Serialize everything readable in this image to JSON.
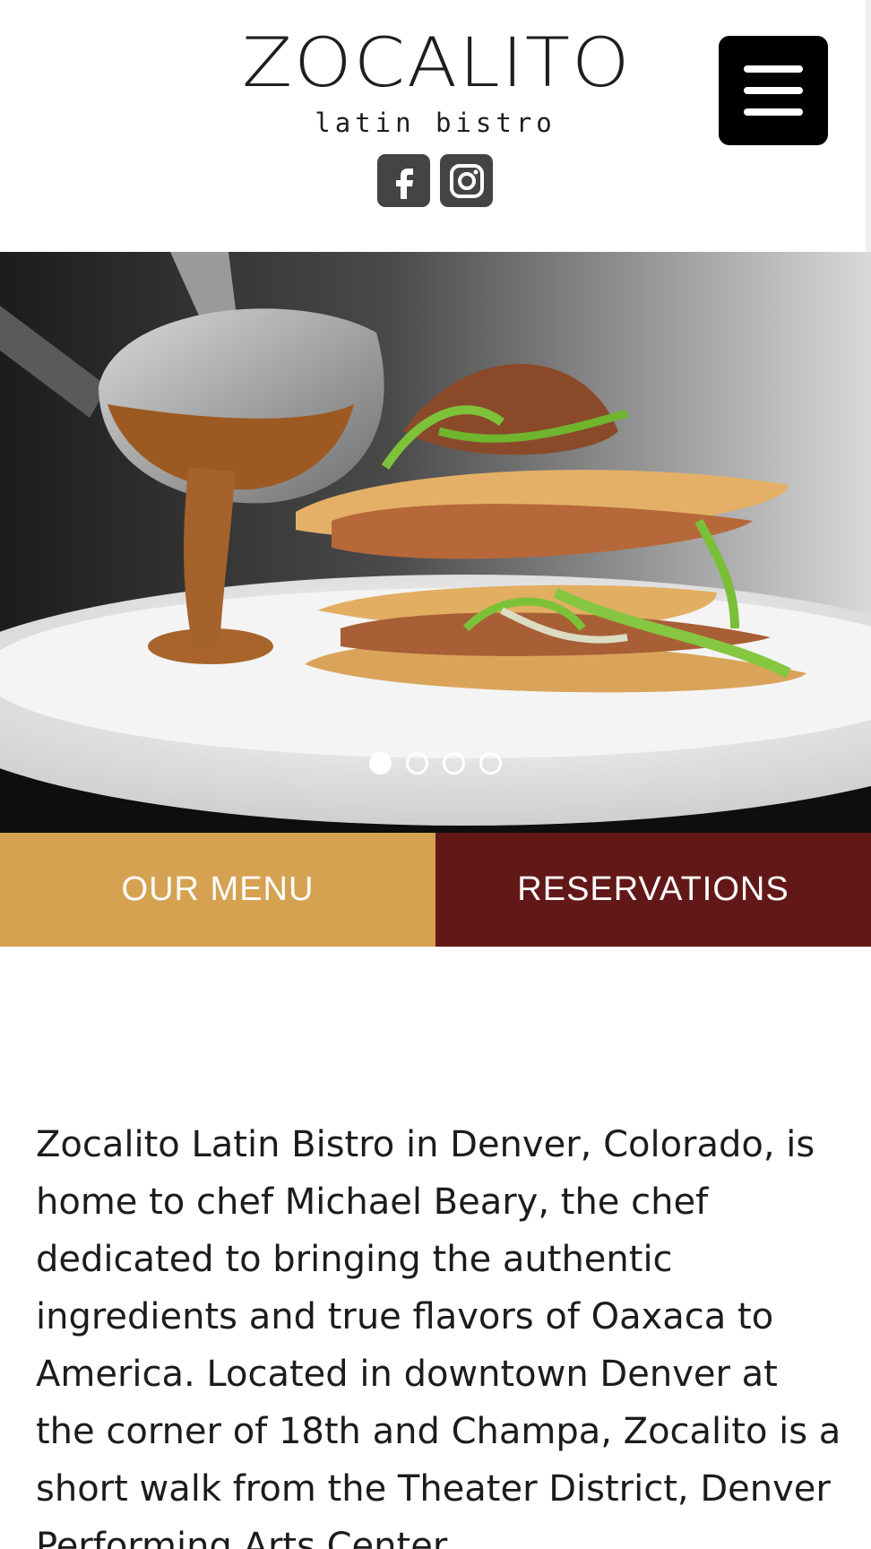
{
  "header": {
    "logo_title": "ZOCALITO",
    "logo_subtitle": "latin bistro",
    "social": [
      {
        "icon": "facebook-icon",
        "label": "f"
      },
      {
        "icon": "instagram-icon"
      }
    ],
    "menu_icon": "hamburger-icon"
  },
  "hero": {
    "slides_count": 4,
    "active_slide": 1
  },
  "cta": {
    "menu_label": "OUR MENU",
    "reservations_label": "RESERVATIONS"
  },
  "intro": {
    "text": "Zocalito Latin Bistro in Denver, Colorado, is home to chef Michael Beary, the chef dedicated to bringing the authentic ingredients and true flavors of Oaxaca to America. Located in downtown Denver at the corner of 18th and Champa, Zocalito is a short walk from the Theater District, Denver Performing Arts Center"
  },
  "colors": {
    "menu_button": "#d5a252",
    "reservations_button": "#631818",
    "social_button": "#444444"
  }
}
